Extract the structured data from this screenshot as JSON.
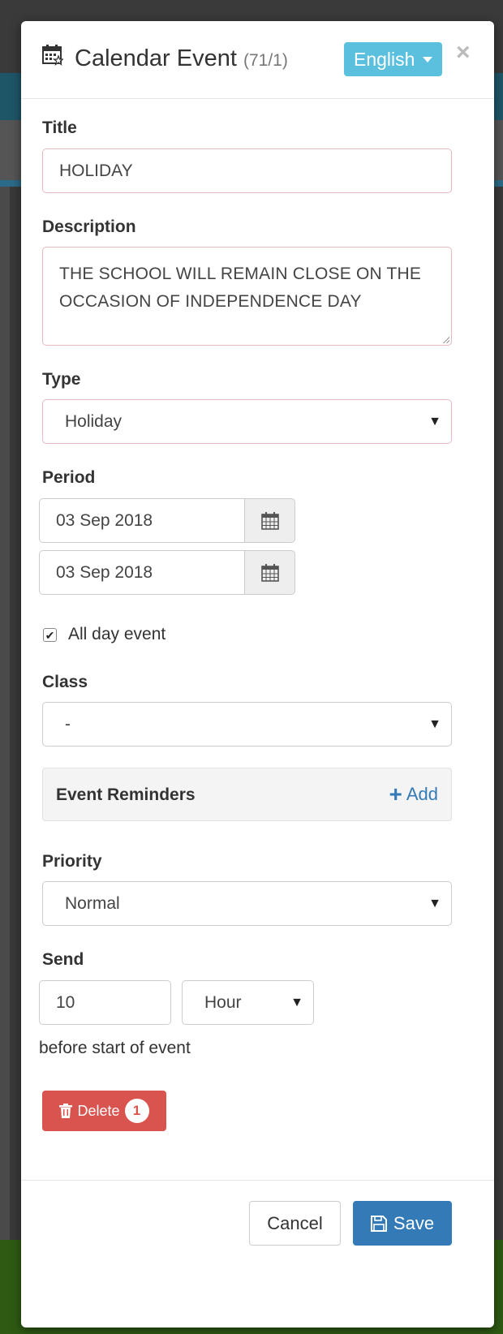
{
  "modal": {
    "title": "Calendar Event",
    "count": "(71/1)",
    "language": "English",
    "close": "×"
  },
  "form": {
    "title_label": "Title",
    "title_value": "HOLIDAY",
    "description_label": "Description",
    "description_value": "THE SCHOOL WILL REMAIN CLOSE ON THE OCCASION OF INDEPENDENCE DAY",
    "type_label": "Type",
    "type_value": "Holiday",
    "period_label": "Period",
    "period_start": "03 Sep 2018",
    "period_end": "03 Sep 2018",
    "all_day_label": "All day event",
    "all_day_checked": true,
    "class_label": "Class",
    "class_value": "-",
    "reminders_title": "Event Reminders",
    "reminders_add": "Add",
    "priority_label": "Priority",
    "priority_value": "Normal",
    "send_label": "Send",
    "send_value": "10",
    "send_unit": "Hour",
    "before_text": "before start of event"
  },
  "actions": {
    "delete_label": "Delete",
    "delete_badge": "1",
    "cancel_label": "Cancel",
    "save_label": "Save"
  },
  "colors": {
    "language_button": "#5bc0de",
    "delete_button": "#d9534f",
    "save_button": "#337ab7",
    "link": "#337ab7",
    "field_border_required": "#e4b9c0"
  }
}
